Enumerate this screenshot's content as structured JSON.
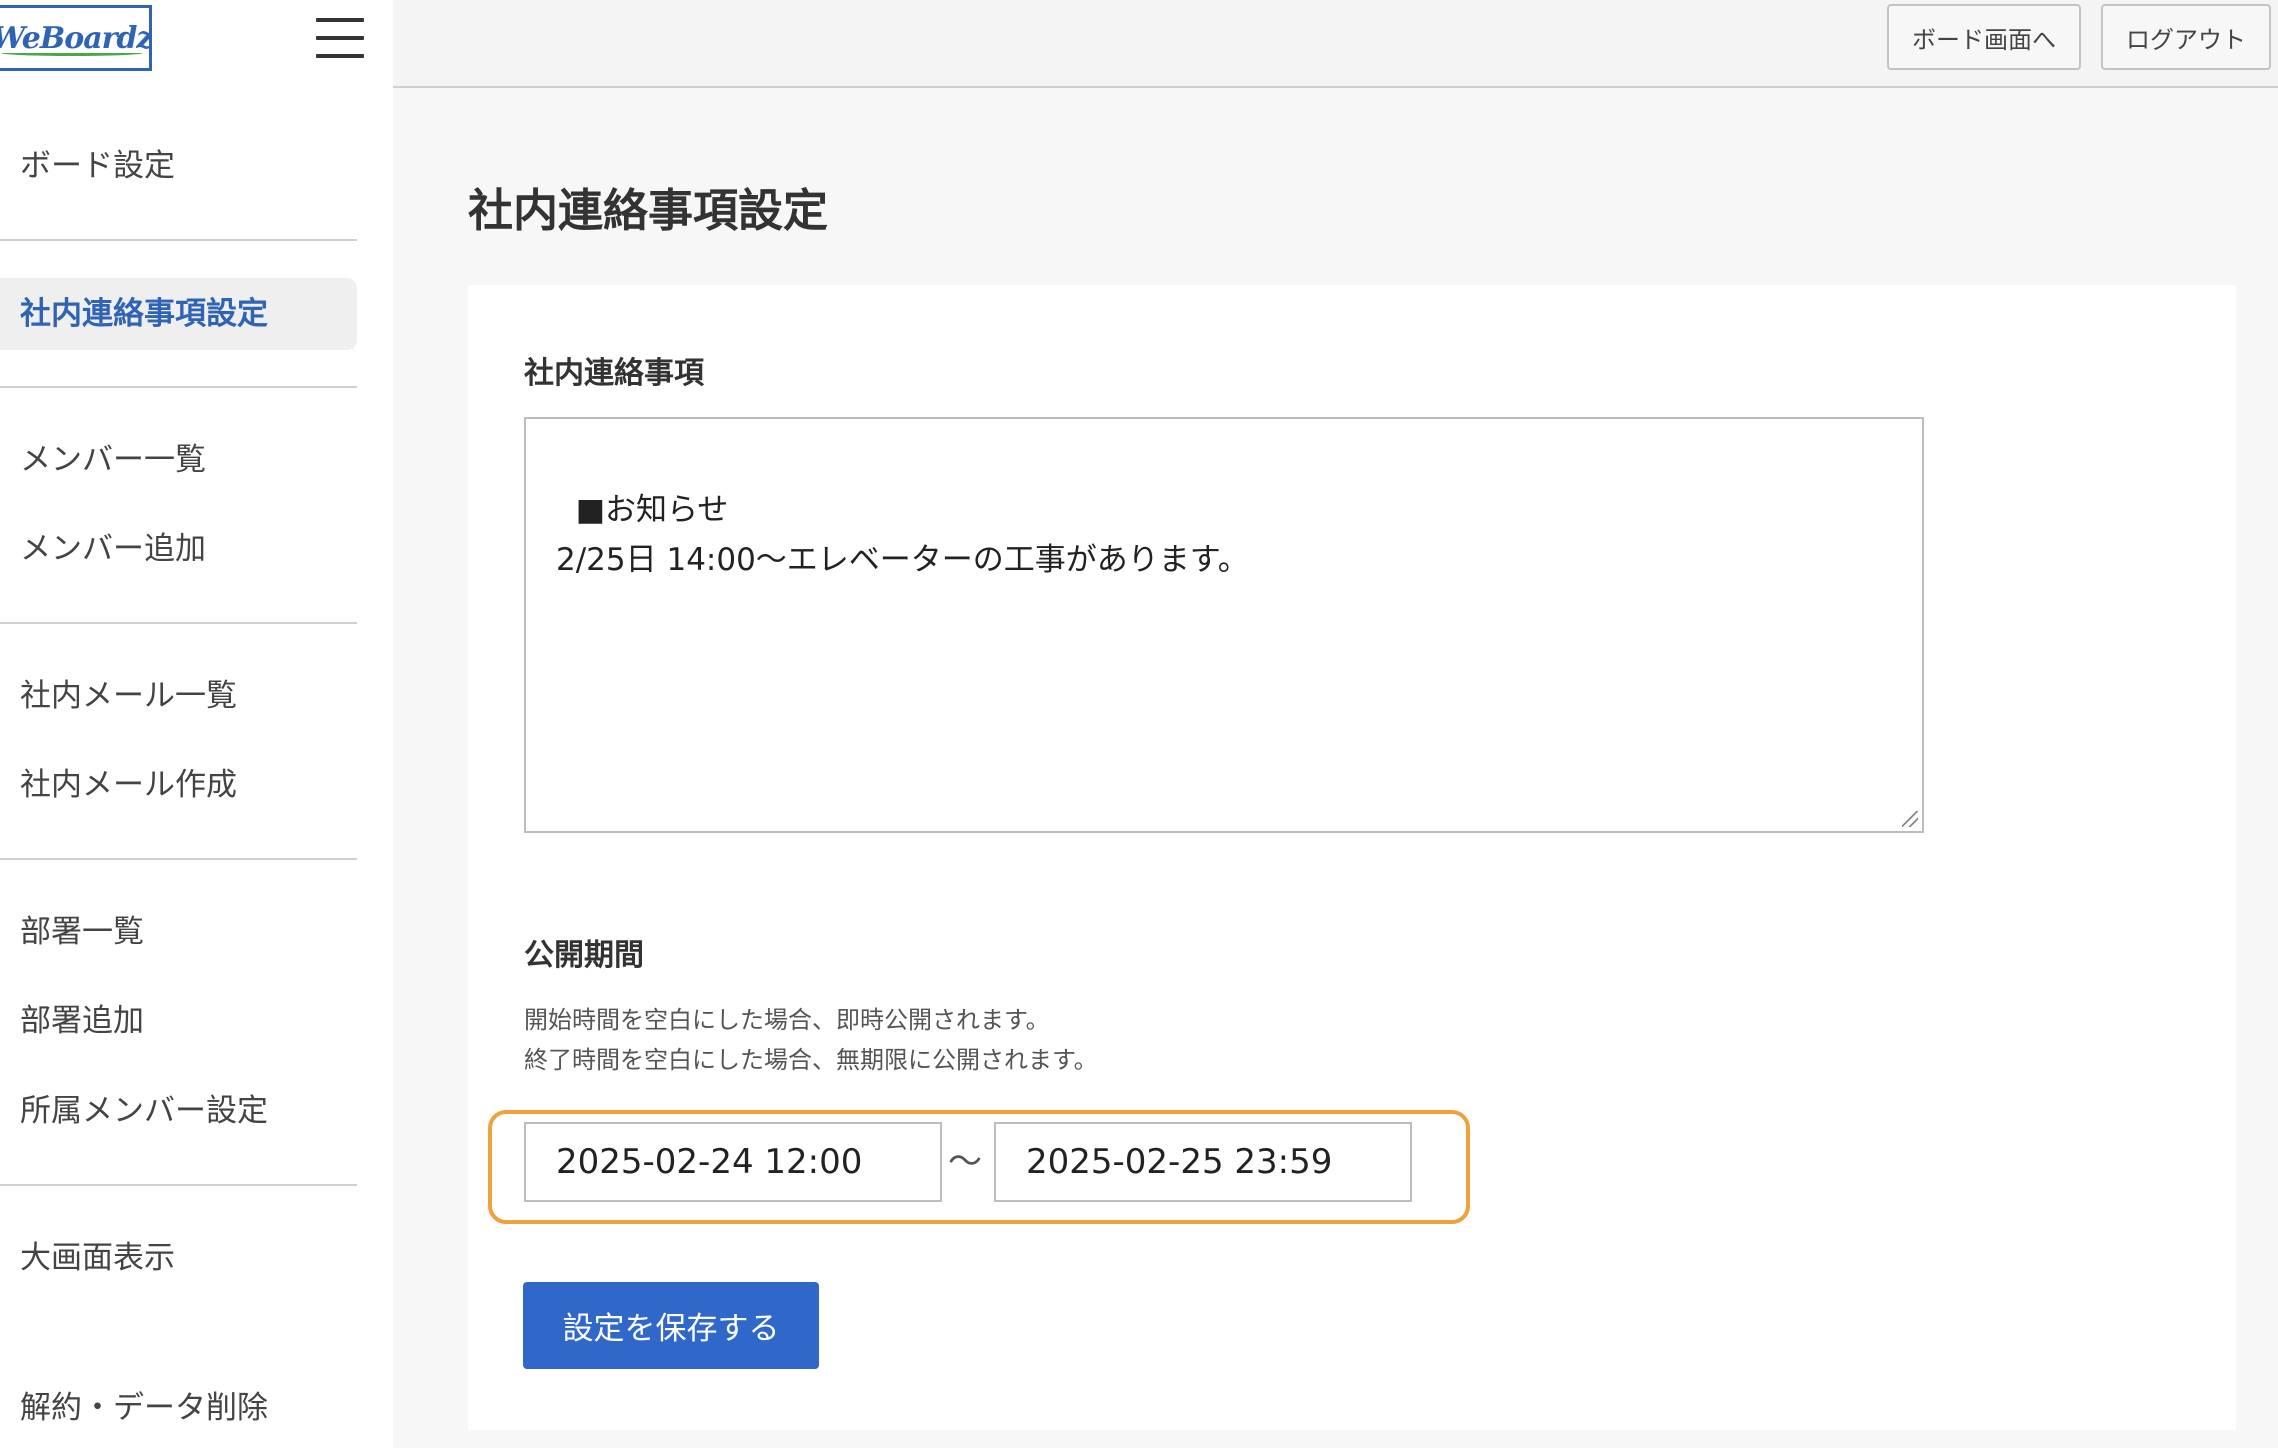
{
  "app": {
    "logo_text": "WeBoardz"
  },
  "sidebar": {
    "items": [
      {
        "label": "ボード設定"
      },
      {
        "label": "社内連絡事項設定",
        "active": true
      },
      {
        "label": "メンバー一覧"
      },
      {
        "label": "メンバー追加"
      },
      {
        "label": "社内メール一覧"
      },
      {
        "label": "社内メール作成"
      },
      {
        "label": "部署一覧"
      },
      {
        "label": "部署追加"
      },
      {
        "label": "所属メンバー設定"
      },
      {
        "label": "大画面表示"
      },
      {
        "label": "解約・データ削除"
      }
    ]
  },
  "header": {
    "board_button": "ボード画面へ",
    "logout_button": "ログアウト"
  },
  "main": {
    "title": "社内連絡事項設定",
    "notice": {
      "label": "社内連絡事項",
      "value": "■お知らせ\n2/25日 14:00〜エレベーターの工事があります。"
    },
    "period": {
      "label": "公開期間",
      "help_line1": "開始時間を空白にした場合、即時公開されます。",
      "help_line2": "終了時間を空白にした場合、無期限に公開されます。",
      "start_value": "2025-02-24 12:00",
      "separator": "〜",
      "end_value": "2025-02-25 23:59"
    },
    "save_button": "設定を保存する"
  },
  "colors": {
    "accent": "#2f64b5",
    "primary_button": "#2f68c9",
    "highlight": "#eea23c"
  }
}
